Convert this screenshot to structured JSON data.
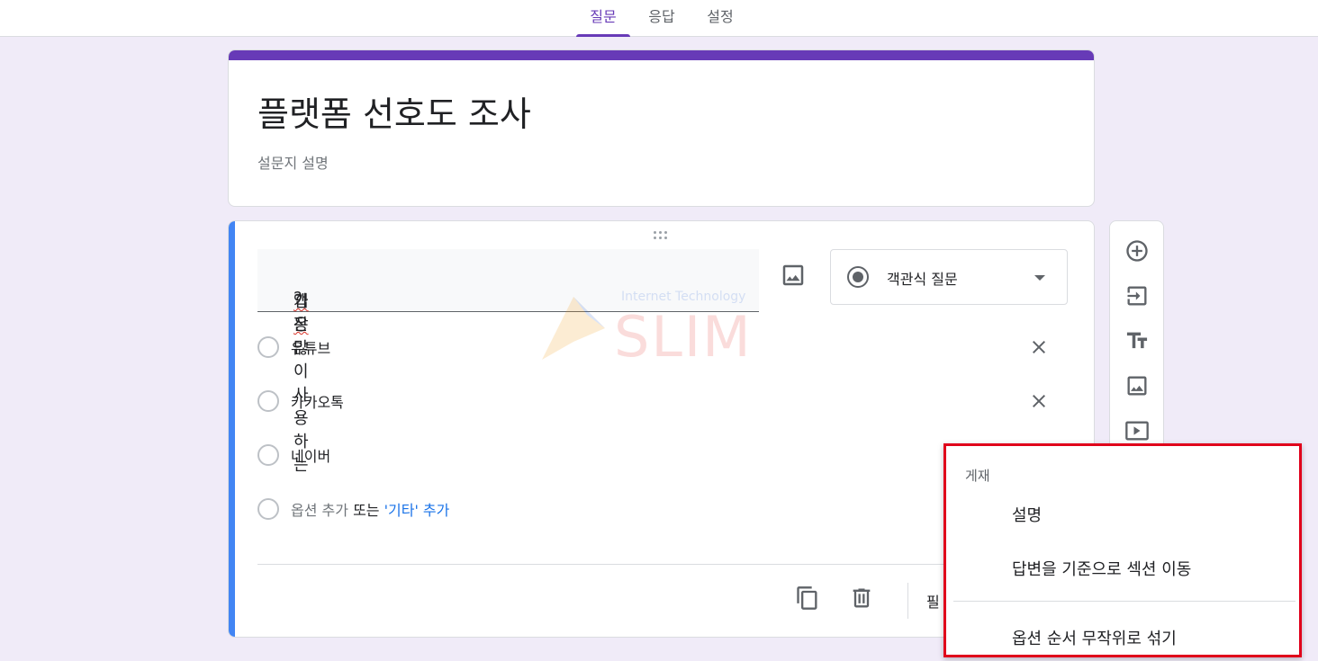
{
  "tabs": [
    {
      "label": "질문",
      "active": true
    },
    {
      "label": "응답",
      "active": false
    },
    {
      "label": "설정",
      "active": false
    }
  ],
  "form": {
    "title": "플랫폼 선호도 조사",
    "description": "설문지 설명"
  },
  "question": {
    "text_before": "가장 많이 사용하는 ",
    "text_spell": "앱은",
    "text_after": "?",
    "type_label": "객관식 질문",
    "options": [
      {
        "label": "유튜브"
      },
      {
        "label": "카카오톡"
      },
      {
        "label": "네이버"
      }
    ],
    "add_option": "옵션 추가",
    "add_or": "또는",
    "add_other": "'기타' 추가",
    "required_label": "필"
  },
  "menu": {
    "header": "게재",
    "items": [
      {
        "label": "설명"
      },
      {
        "label": "답변을 기준으로 섹션 이동"
      },
      {
        "label": "옵션 순서 무작위로 섞기"
      }
    ]
  },
  "watermark": {
    "subtitle": "Internet Technology",
    "main": "SLIM"
  },
  "colors": {
    "accent": "#673ab7",
    "question_band": "#4285f4",
    "background": "#f0ebf8",
    "highlight_box": "#e0001b",
    "link": "#1a73e8"
  }
}
